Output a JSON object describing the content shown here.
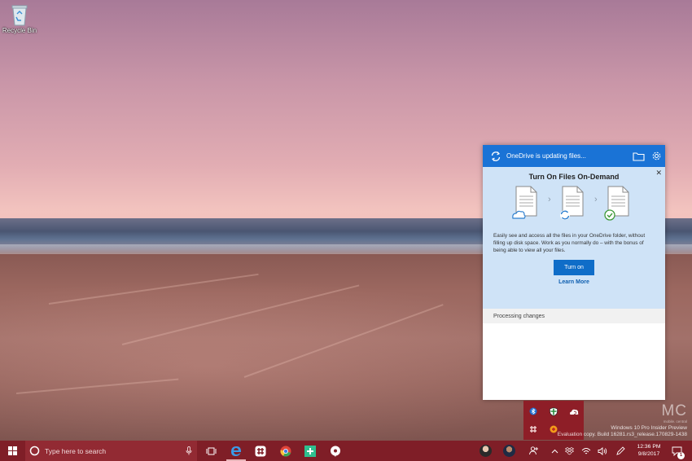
{
  "desktop": {
    "icons": [
      {
        "label": "Recycle Bin",
        "icon": "recycle-bin-icon"
      }
    ]
  },
  "onedrive": {
    "status": "OneDrive is updating files...",
    "promo": {
      "title": "Turn On Files On-Demand",
      "description": "Easily see and access all the files in your OneDrive folder, without filling up disk space. Work as you normally do – with the bonus of being able to view all your files.",
      "button": "Turn on",
      "link": "Learn More"
    },
    "activity": "Processing changes",
    "colors": {
      "header": "#1a73d6",
      "promo_bg": "#cfe3f7",
      "button": "#0f6dc8"
    }
  },
  "taskbar": {
    "search_placeholder": "Type here to search",
    "apps": [
      "task-view-icon",
      "edge-icon",
      "slack-icon",
      "chrome-icon",
      "plus-app-icon",
      "chat-app-icon"
    ],
    "clock": {
      "time": "12:36 PM",
      "date": "9/8/2017"
    },
    "notification_count": "1",
    "color": "#7f1e27"
  },
  "watermark": {
    "logo": "MC",
    "small": "mobile. central",
    "line1": "Windows 10 Pro Insider Preview",
    "line2": "Evaluation copy. Build 16281.rs3_release.170829-1438"
  }
}
